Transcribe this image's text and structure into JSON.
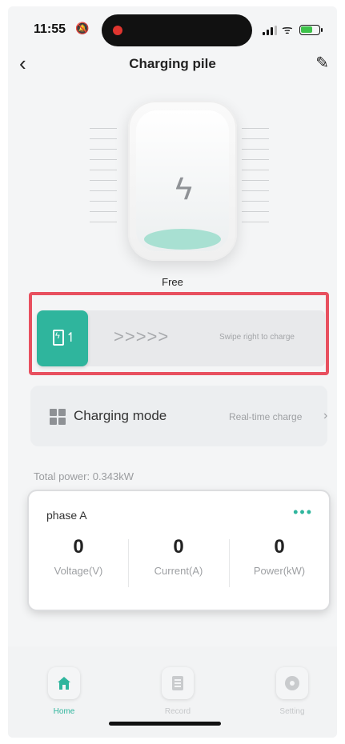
{
  "status_bar": {
    "time": "11:55"
  },
  "header": {
    "title": "Charging pile"
  },
  "device": {
    "status": "Free"
  },
  "swipe": {
    "hint": "Swipe right to charge",
    "chevrons": ">>>>>"
  },
  "charging_mode": {
    "label": "Charging mode",
    "value": "Real-time charge"
  },
  "total_power": {
    "label": "Total power:",
    "value": "0.343kW"
  },
  "phase": {
    "label": "phase A",
    "metrics": [
      {
        "value": "0",
        "label": "Voltage(V)"
      },
      {
        "value": "0",
        "label": "Current(A)"
      },
      {
        "value": "0",
        "label": "Power(kW)"
      }
    ]
  },
  "tabs": [
    {
      "label": "Home",
      "icon": "home-icon",
      "active": true
    },
    {
      "label": "Record",
      "icon": "record-icon",
      "active": false
    },
    {
      "label": "Setting",
      "icon": "gear-icon",
      "active": false
    }
  ],
  "colors": {
    "accent": "#2fb59d",
    "highlight": "#e8505f",
    "background": "#f4f5f6"
  }
}
